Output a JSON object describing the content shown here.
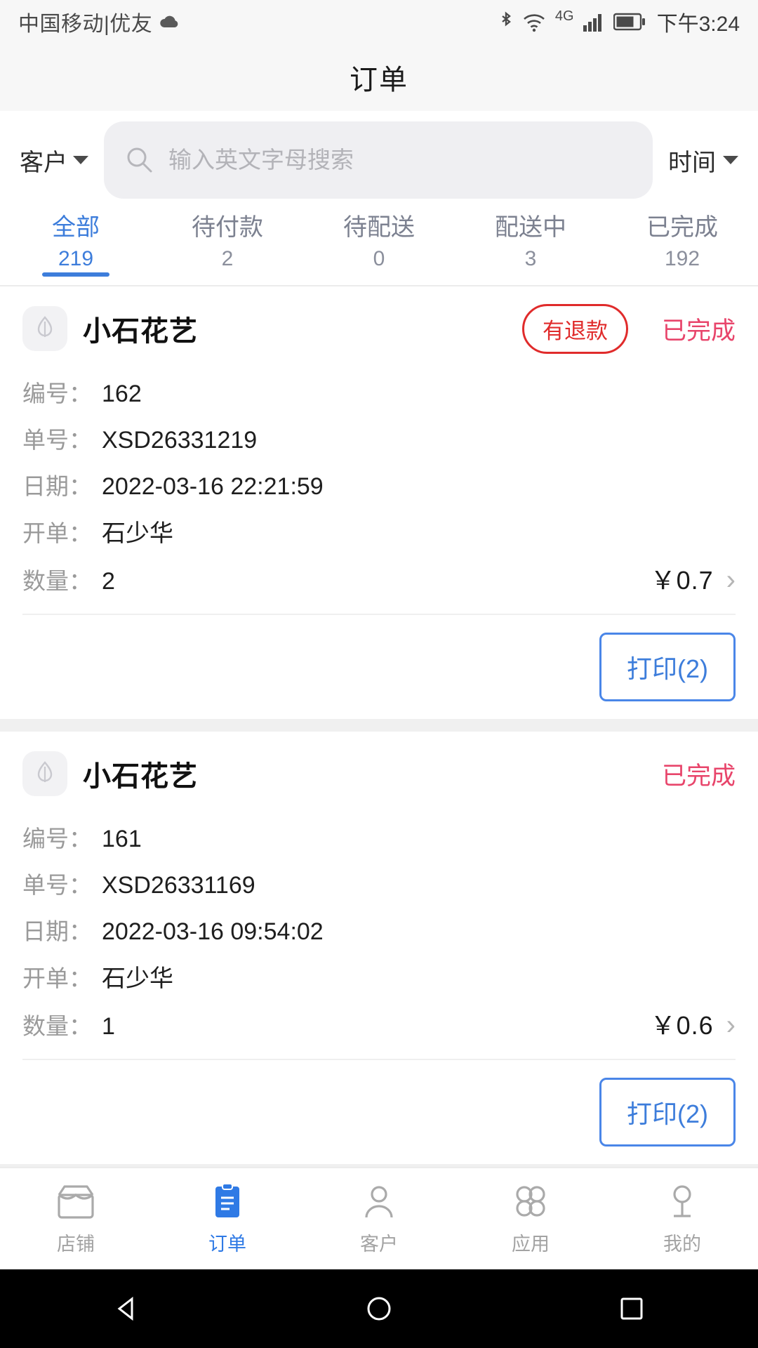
{
  "status_bar": {
    "carrier": "中国移动|优友",
    "cloud_icon": "cloud-icon",
    "bluetooth_icon": "bluetooth-icon",
    "wifi_icon": "wifi-icon",
    "network_label": "4G",
    "signal_icon": "signal-icon",
    "battery_icon": "battery-icon",
    "time": "下午3:24"
  },
  "header": {
    "title": "订单"
  },
  "search": {
    "customer_filter_label": "客户",
    "search_icon": "search-icon",
    "placeholder": "输入英文字母搜索",
    "value": "",
    "time_filter_label": "时间"
  },
  "tabs": [
    {
      "label": "全部",
      "count": "219",
      "active": true
    },
    {
      "label": "待付款",
      "count": "2",
      "active": false
    },
    {
      "label": "待配送",
      "count": "0",
      "active": false
    },
    {
      "label": "配送中",
      "count": "3",
      "active": false
    },
    {
      "label": "已完成",
      "count": "192",
      "active": false
    }
  ],
  "labels": {
    "code": "编号：",
    "order_no": "单号：",
    "date": "日期：",
    "operator": "开单：",
    "quantity": "数量：",
    "print": "打印(2)"
  },
  "orders": [
    {
      "shop": "小石花艺",
      "refund_badge": "有退款",
      "status": "已完成",
      "code": "162",
      "order_no": "XSD26331219",
      "date": "2022-03-16 22:21:59",
      "operator": "石少华",
      "quantity": "2",
      "amount": "￥0.7",
      "print_label": "打印(2)"
    },
    {
      "shop": "小石花艺",
      "refund_badge": "",
      "status": "已完成",
      "code": "161",
      "order_no": "XSD26331169",
      "date": "2022-03-16 09:54:02",
      "operator": "石少华",
      "quantity": "1",
      "amount": "￥0.6",
      "print_label": "打印(2)"
    }
  ],
  "bottom_nav": [
    {
      "label": "店铺",
      "icon": "shop-icon",
      "active": false
    },
    {
      "label": "订单",
      "icon": "order-clipboard-icon",
      "active": true
    },
    {
      "label": "客户",
      "icon": "customer-person-icon",
      "active": false
    },
    {
      "label": "应用",
      "icon": "apps-grid-icon",
      "active": false
    },
    {
      "label": "我的",
      "icon": "profile-icon",
      "active": false
    }
  ],
  "android_nav": {
    "back": "back-triangle-icon",
    "home": "home-circle-icon",
    "recents": "recents-square-icon"
  },
  "colors": {
    "accent_blue": "#3d7ddb",
    "status_red": "#e8456b",
    "refund_red": "#e02b2b",
    "muted_gray": "#9a9a9a"
  }
}
